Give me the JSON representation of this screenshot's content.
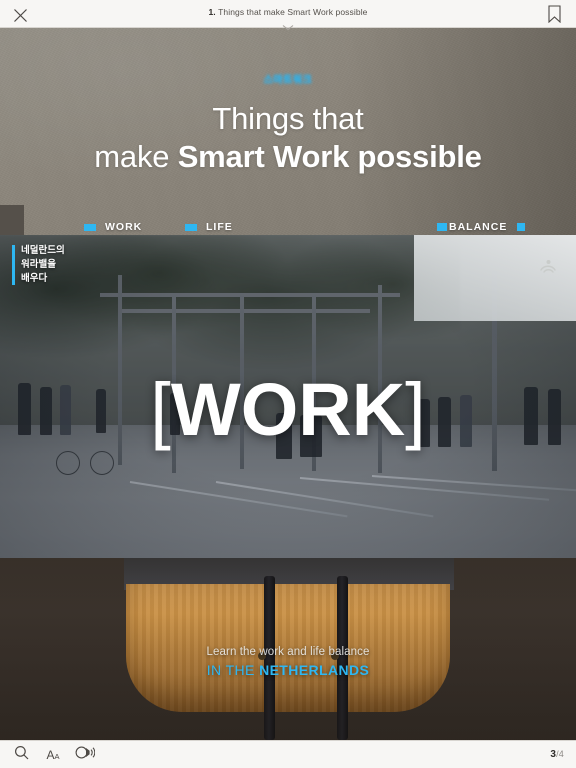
{
  "topbar": {
    "close_icon": "close-icon",
    "title_number": "1.",
    "title_text": "Things that  make Smart Work possible",
    "chevron_icon": "chevron-down-icon",
    "bookmark_icon": "bookmark-icon"
  },
  "hero": {
    "kicker": "스마트워크",
    "heading_line1": "Things that",
    "heading_line2_light": "make ",
    "heading_line2_bold": "Smart Work possible",
    "chips": [
      {
        "label": "WORK"
      },
      {
        "label": "LIFE"
      },
      {
        "label": "BALANCE"
      }
    ]
  },
  "photo": {
    "korean_line1": "네덜란드의",
    "korean_line2": "워라밸을",
    "korean_line3": "배우다",
    "work_open_bracket": "[",
    "work_label": "WORK",
    "work_close_bracket": "]"
  },
  "footer_caption": {
    "line1": "Learn the work and life balance",
    "line2_light": "IN THE ",
    "line2_bold": "NETHERLANDS"
  },
  "bottombar": {
    "search_icon": "search-icon",
    "font_size_label": "A",
    "font_size_label_small": "A",
    "audio_icon": "audio-speaker-icon",
    "current_page": "3",
    "page_separator": "/4"
  },
  "colors": {
    "accent_cyan": "#2eb7f2",
    "wall_gray": "#8b857b",
    "bottom_brown": "#3a322c",
    "chrome_bg": "#f7f6f4"
  }
}
